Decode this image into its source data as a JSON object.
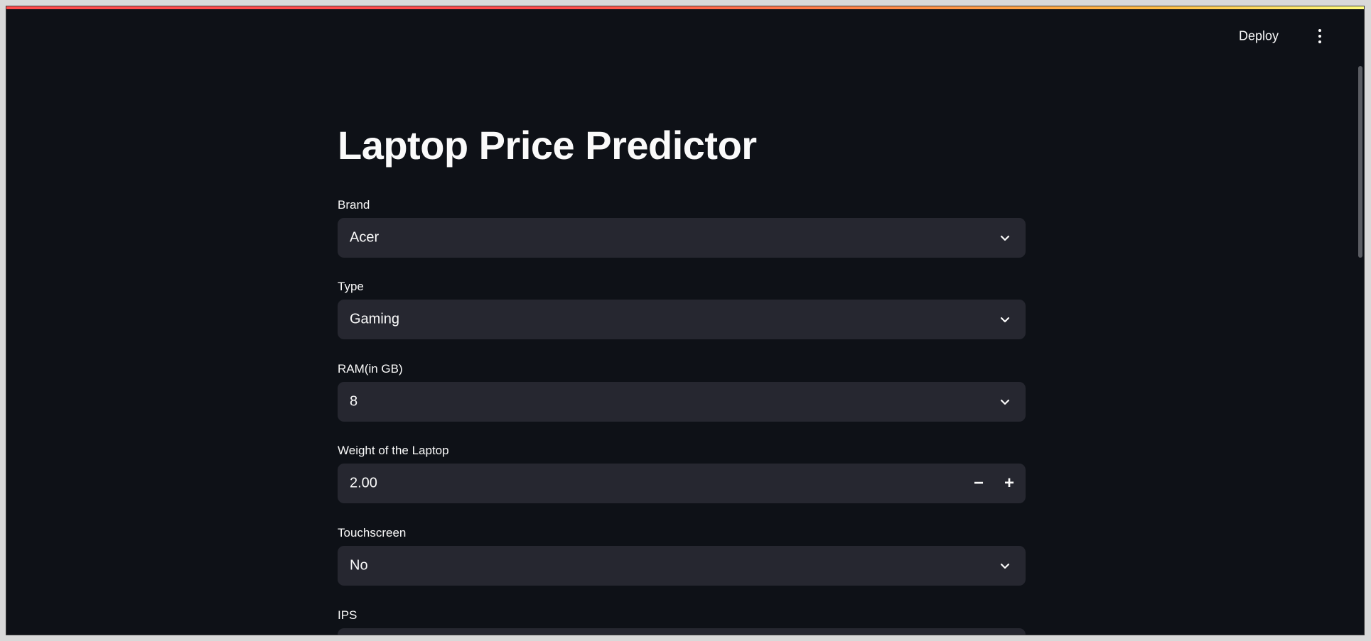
{
  "header": {
    "deploy_label": "Deploy",
    "menu_icon": "kebab-menu-icon"
  },
  "main": {
    "title": "Laptop Price Predictor",
    "fields": {
      "brand": {
        "label": "Brand",
        "value": "Acer"
      },
      "type": {
        "label": "Type",
        "value": "Gaming"
      },
      "ram": {
        "label": "RAM(in GB)",
        "value": "8"
      },
      "weight": {
        "label": "Weight of the Laptop",
        "value": "2.00",
        "minus": "−",
        "plus": "+"
      },
      "touchscreen": {
        "label": "Touchscreen",
        "value": "No"
      },
      "ips": {
        "label": "IPS"
      }
    }
  },
  "colors": {
    "background": "#0e1117",
    "input_bg": "#262730",
    "text": "#fafafa",
    "accent_red": "#ff4b4b",
    "accent_yellow": "#fffd80"
  }
}
